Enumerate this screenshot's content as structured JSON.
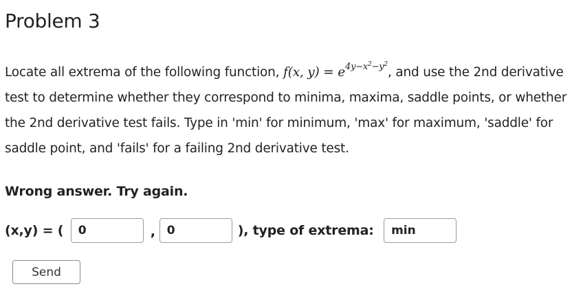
{
  "problem": {
    "title": "Problem 3",
    "text_before_formula": "Locate all extrema of the following function, ",
    "formula_lhs": "f(x, y)",
    "formula_eq": " = ",
    "formula_base": "e",
    "formula_exp_a": "4y−x",
    "formula_exp_b": "2",
    "formula_exp_c": "−y",
    "formula_exp_d": "2",
    "text_after_formula": ", and use the 2nd derivative test to determine whether they correspond to minima, maxima, saddle points, or whether the 2nd derivative test fails. Type in 'min' for minimum, 'max' for maximum, 'saddle' for saddle point, and 'fails' for a failing 2nd derivative test."
  },
  "feedback": {
    "message": "Wrong answer. Try again."
  },
  "answer": {
    "prefix": "(x,y) = ( ",
    "x_value": "0",
    "separator": ",",
    "y_value": "0",
    "middle_text": "), type of extrema: ",
    "type_value": "min"
  },
  "actions": {
    "send_label": "Send"
  }
}
